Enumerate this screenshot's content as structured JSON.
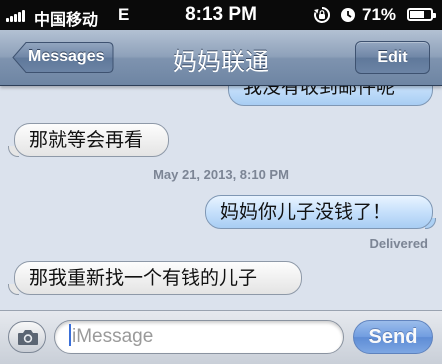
{
  "status_bar": {
    "carrier": "中国移动",
    "network": "E",
    "time": "8:13 PM",
    "battery": "71%",
    "battery_level": 0.71,
    "icons": [
      "signal-icon",
      "lock-rotation-icon",
      "alarm-icon",
      "battery-icon"
    ]
  },
  "nav": {
    "back_label": "Messages",
    "title": "妈妈联通",
    "edit_label": "Edit"
  },
  "messages": [
    {
      "direction": "outgoing",
      "text": "我没有收到邮件呢"
    },
    {
      "direction": "incoming",
      "text": "那就等会再看"
    },
    {
      "direction": "outgoing",
      "text": "妈妈你儿子没钱了！"
    },
    {
      "direction": "incoming",
      "text": "那我重新找一个有钱的儿子"
    }
  ],
  "timestamp": "May 21, 2013, 8:10 PM",
  "delivered": "Delivered",
  "input": {
    "placeholder": "iMessage",
    "send_label": "Send"
  },
  "colors": {
    "outgoing_bubble": "#c6e0fb",
    "incoming_bubble": "#f2f2f2",
    "nav_bar": "#8ea1ba",
    "send_button": "#5f92e0"
  }
}
